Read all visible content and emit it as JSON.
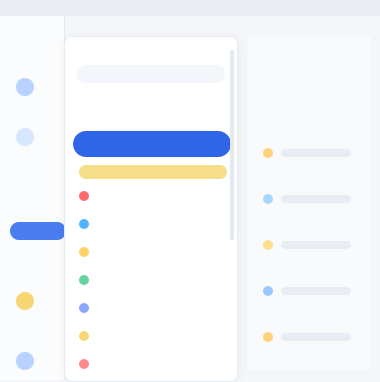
{
  "colors": {
    "accent": "#2f66e8",
    "highlight": "#f7de8a",
    "leftnav_pill": "#4b7cf0"
  },
  "nav": {
    "icons": [
      "circle-icon",
      "circle-icon",
      "circle-icon",
      "circle-icon",
      "circle-icon"
    ]
  },
  "menu": {
    "items": [
      {
        "label": "",
        "icon": "dot-icon",
        "color": "#ff6b6b"
      },
      {
        "label": "",
        "icon": "dot-icon",
        "color": "#50b3ff"
      },
      {
        "label": "",
        "icon": "dot-icon",
        "color": "#ffd166"
      },
      {
        "label": "",
        "icon": "dot-icon",
        "color": "#62d2a2"
      },
      {
        "label": "",
        "icon": "dot-icon",
        "color": "#8aa7ff"
      },
      {
        "label": "",
        "icon": "dot-icon",
        "color": "#f7d774"
      },
      {
        "label": "",
        "icon": "dot-icon",
        "color": "#ff8a8a"
      },
      {
        "label": "",
        "icon": "dot-icon",
        "color": "#6ec6ff"
      }
    ]
  },
  "right_panel": {
    "dots": [
      "#ffd27a",
      "#a6d8ff",
      "#ffe08a",
      "#9cc7ff",
      "#ffd27a",
      "#a6d8ff"
    ]
  }
}
